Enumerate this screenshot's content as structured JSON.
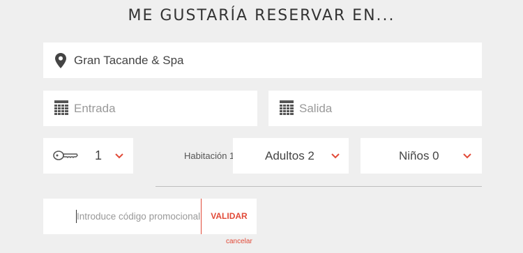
{
  "heading": "ME GUSTARÍA RESERVAR EN...",
  "hotel": {
    "value": "Gran Tacande & Spa",
    "icon": "location-pin-icon"
  },
  "dates": {
    "checkin_placeholder": "Entrada",
    "checkout_placeholder": "Salida",
    "icon": "calendar-icon"
  },
  "rooms": {
    "value": "1",
    "icon": "key-icon"
  },
  "room_label": "Habitación 1",
  "adults": "Adultos 2",
  "children": "Niños 0",
  "promo": {
    "placeholder": "Introduce código promocional",
    "button": "VALIDAR"
  },
  "cancel": "cancelar",
  "colors": {
    "accent": "#e14a38",
    "background": "#efefef",
    "field": "#ffffff"
  }
}
